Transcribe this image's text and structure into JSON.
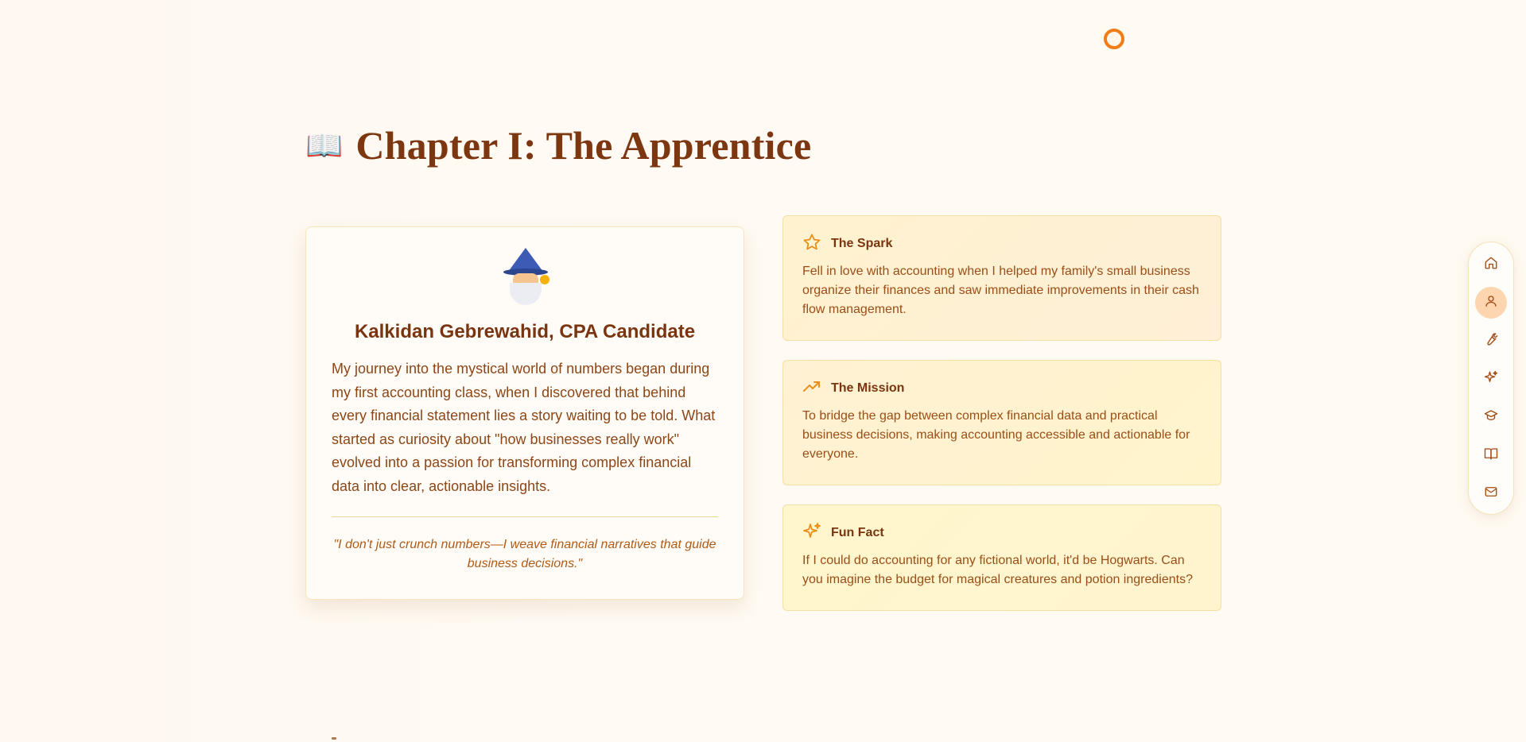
{
  "chapter": {
    "icon": "open-book-icon",
    "title": "Chapter I: The Apprentice"
  },
  "profile": {
    "avatar": "wizard-icon",
    "name": "Kalkidan Gebrewahid, CPA Candidate",
    "story": "My journey into the mystical world of numbers began during my first accounting class, when I discovered that behind every financial statement lies a story waiting to be told. What started as curiosity about \"how businesses really work\" evolved into a passion for transforming complex financial data into clear, actionable insights.",
    "quote": "\"I don't just crunch numbers—I weave financial narratives that guide business decisions.\""
  },
  "cards": [
    {
      "icon": "star-icon",
      "title": "The Spark",
      "body": "Fell in love with accounting when I helped my family's small business organize their finances and saw immediate improvements in their cash flow management."
    },
    {
      "icon": "trending-up-icon",
      "title": "The Mission",
      "body": "To bridge the gap between complex financial data and practical business decisions, making accounting accessible and actionable for everyone."
    },
    {
      "icon": "sparkles-icon",
      "title": "Fun Fact",
      "body": "If I could do accounting for any fictional world, it'd be Hogwarts. Can you imagine the budget for magical creatures and potion ingredients?"
    }
  ],
  "side_nav": {
    "items": [
      {
        "icon": "home-icon",
        "active": false
      },
      {
        "icon": "user-icon",
        "active": true
      },
      {
        "icon": "wrench-icon",
        "active": false
      },
      {
        "icon": "sparkles-icon",
        "active": false
      },
      {
        "icon": "graduation-cap-icon",
        "active": false
      },
      {
        "icon": "book-icon",
        "active": false
      },
      {
        "icon": "mail-icon",
        "active": false
      }
    ]
  },
  "colors": {
    "accent": "#f07d16",
    "heading": "#7c3610",
    "text": "#8d4616",
    "active_nav_bg": "#fdd6b0",
    "card_border": "#f6e0a3"
  }
}
